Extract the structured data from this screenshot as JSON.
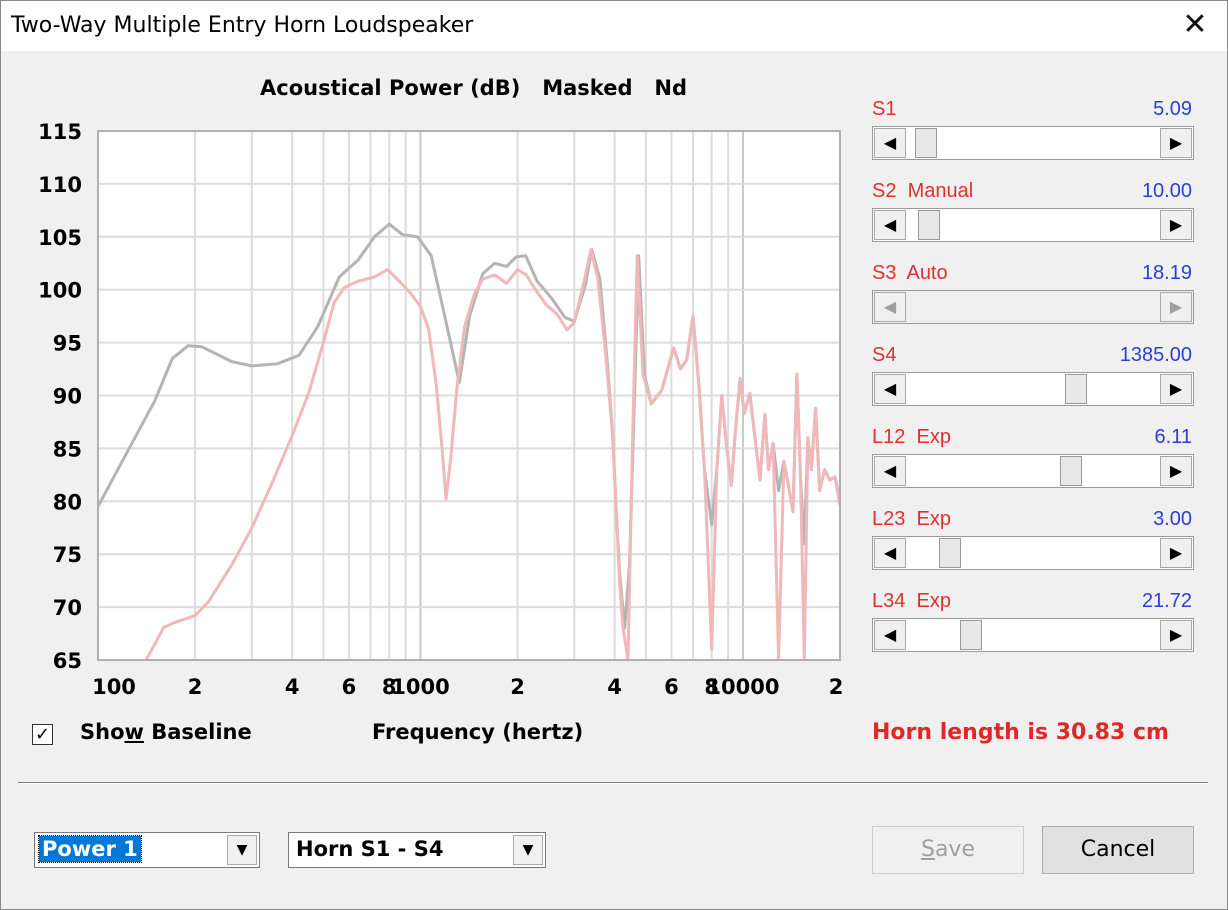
{
  "window": {
    "title": "Two-Way Multiple Entry Horn Loudspeaker",
    "close_glyph": "✕"
  },
  "chart_data": {
    "type": "line",
    "title": "Acoustical Power (dB)   Masked   Nd",
    "xlabel": "Frequency (hertz)",
    "ylabel": "",
    "xscale": "log",
    "xlim": [
      100,
      20000
    ],
    "ylim": [
      65,
      115
    ],
    "yticks": [
      115,
      110,
      105,
      100,
      95,
      90,
      85,
      80,
      75,
      70,
      65
    ],
    "xtick_labels": [
      {
        "x": 100,
        "label": "100"
      },
      {
        "x": 200,
        "label": "2"
      },
      {
        "x": 400,
        "label": "4"
      },
      {
        "x": 600,
        "label": "6"
      },
      {
        "x": 800,
        "label": "8"
      },
      {
        "x": 1000,
        "label": "1000"
      },
      {
        "x": 2000,
        "label": "2"
      },
      {
        "x": 4000,
        "label": "4"
      },
      {
        "x": 6000,
        "label": "6"
      },
      {
        "x": 8000,
        "label": "8"
      },
      {
        "x": 10000,
        "label": "10000"
      },
      {
        "x": 20000,
        "label": "2"
      }
    ],
    "grid": true,
    "series": [
      {
        "color": "#b4b4b4",
        "points": [
          [
            100,
            79.5
          ],
          [
            120,
            84
          ],
          [
            150,
            89.5
          ],
          [
            170,
            93.5
          ],
          [
            190,
            94.7
          ],
          [
            210,
            94.6
          ],
          [
            260,
            93.2
          ],
          [
            300,
            92.8
          ],
          [
            360,
            93.0
          ],
          [
            420,
            93.8
          ],
          [
            480,
            96.5
          ],
          [
            560,
            101.2
          ],
          [
            640,
            102.8
          ],
          [
            720,
            105.0
          ],
          [
            800,
            106.2
          ],
          [
            880,
            105.2
          ],
          [
            980,
            105.0
          ],
          [
            1080,
            103.2
          ],
          [
            1160,
            99
          ],
          [
            1240,
            95
          ],
          [
            1320,
            91.2
          ],
          [
            1420,
            97.5
          ],
          [
            1560,
            101.5
          ],
          [
            1700,
            102.5
          ],
          [
            1850,
            102.2
          ],
          [
            1980,
            103.1
          ],
          [
            2120,
            103.2
          ],
          [
            2300,
            100.8
          ],
          [
            2550,
            99.2
          ],
          [
            2800,
            97.4
          ],
          [
            3000,
            97.0
          ],
          [
            3250,
            100.5
          ],
          [
            3400,
            103.8
          ],
          [
            3600,
            101
          ],
          [
            3800,
            93
          ],
          [
            3950,
            86
          ],
          [
            4050,
            79
          ],
          [
            4150,
            73
          ],
          [
            4300,
            68
          ],
          [
            4450,
            74
          ],
          [
            4600,
            89
          ],
          [
            4750,
            103.2
          ],
          [
            4950,
            92
          ],
          [
            5200,
            89.2
          ],
          [
            5600,
            90.5
          ],
          [
            6100,
            94.5
          ],
          [
            6400,
            92.5
          ],
          [
            6700,
            93.4
          ],
          [
            7000,
            97.5
          ],
          [
            7300,
            91
          ],
          [
            7600,
            83
          ],
          [
            8000,
            77.8
          ],
          [
            8300,
            83
          ],
          [
            8600,
            90
          ],
          [
            8900,
            85.2
          ],
          [
            9200,
            81.5
          ],
          [
            9500,
            87
          ],
          [
            9800,
            91.6
          ],
          [
            10100,
            88.3
          ],
          [
            10500,
            90.2
          ],
          [
            10900,
            86
          ],
          [
            11300,
            82
          ],
          [
            11700,
            88.2
          ],
          [
            12000,
            83
          ],
          [
            12400,
            85.5
          ],
          [
            12900,
            81
          ],
          [
            13400,
            83.8
          ],
          [
            13900,
            81.2
          ],
          [
            14300,
            79
          ],
          [
            14700,
            92
          ],
          [
            15100,
            82
          ],
          [
            15500,
            76
          ],
          [
            15900,
            86
          ],
          [
            16300,
            83
          ],
          [
            16800,
            88.8
          ],
          [
            17300,
            81
          ],
          [
            17900,
            83
          ],
          [
            18600,
            82
          ],
          [
            19300,
            82.3
          ],
          [
            20000,
            80.1
          ]
        ]
      },
      {
        "color": "#f0b8b8",
        "points": [
          [
            100,
            57
          ],
          [
            130,
            63
          ],
          [
            150,
            66.5
          ],
          [
            160,
            68.1
          ],
          [
            175,
            68.6
          ],
          [
            200,
            69.2
          ],
          [
            220,
            70.5
          ],
          [
            260,
            74
          ],
          [
            300,
            77.5
          ],
          [
            350,
            82
          ],
          [
            400,
            86.2
          ],
          [
            450,
            90.2
          ],
          [
            500,
            95
          ],
          [
            540,
            98.8
          ],
          [
            580,
            100.2
          ],
          [
            640,
            100.8
          ],
          [
            720,
            101.2
          ],
          [
            790,
            101.9
          ],
          [
            860,
            100.8
          ],
          [
            930,
            99.7
          ],
          [
            1000,
            98.4
          ],
          [
            1060,
            96.3
          ],
          [
            1120,
            91.0
          ],
          [
            1170,
            84.5
          ],
          [
            1200,
            80.2
          ],
          [
            1240,
            84
          ],
          [
            1300,
            91
          ],
          [
            1370,
            96.5
          ],
          [
            1470,
            99.6
          ],
          [
            1560,
            101.0
          ],
          [
            1700,
            101.4
          ],
          [
            1850,
            100.6
          ],
          [
            2000,
            101.9
          ],
          [
            2130,
            101.4
          ],
          [
            2250,
            100.2
          ],
          [
            2450,
            98.6
          ],
          [
            2650,
            97.7
          ],
          [
            2850,
            96.2
          ],
          [
            3000,
            96.9
          ],
          [
            3200,
            100.5
          ],
          [
            3380,
            103.8
          ],
          [
            3550,
            101
          ],
          [
            3750,
            94
          ],
          [
            3950,
            86
          ],
          [
            4050,
            79
          ],
          [
            4150,
            72
          ],
          [
            4250,
            68
          ],
          [
            4400,
            65
          ],
          [
            4550,
            86
          ],
          [
            4700,
            103.2
          ],
          [
            4900,
            92
          ],
          [
            5200,
            89.2
          ],
          [
            5600,
            90.5
          ],
          [
            6100,
            94.5
          ],
          [
            6400,
            92.5
          ],
          [
            6700,
            93.4
          ],
          [
            7000,
            97.5
          ],
          [
            7300,
            91
          ],
          [
            7600,
            83
          ],
          [
            8000,
            66
          ],
          [
            8300,
            83
          ],
          [
            8600,
            90
          ],
          [
            8900,
            85.2
          ],
          [
            9200,
            81.5
          ],
          [
            9500,
            87
          ],
          [
            9800,
            91.6
          ],
          [
            10100,
            88.3
          ],
          [
            10500,
            90.2
          ],
          [
            10900,
            86
          ],
          [
            11300,
            82
          ],
          [
            11700,
            88.2
          ],
          [
            12000,
            83
          ],
          [
            12400,
            85.5
          ],
          [
            12900,
            65
          ],
          [
            13400,
            83.8
          ],
          [
            13900,
            81.2
          ],
          [
            14300,
            79
          ],
          [
            14700,
            92
          ],
          [
            15100,
            82
          ],
          [
            15500,
            65
          ],
          [
            15900,
            86
          ],
          [
            16300,
            83
          ],
          [
            16800,
            88.8
          ],
          [
            17300,
            81
          ],
          [
            17900,
            83
          ],
          [
            18600,
            82
          ],
          [
            19300,
            82.3
          ],
          [
            20000,
            79.6
          ]
        ]
      }
    ]
  },
  "baseline": {
    "checked": true,
    "check_glyph": "✓",
    "label_pre": "Sho",
    "label_ul": "w",
    "label_post": " Baseline"
  },
  "sliders": [
    {
      "label": "S1",
      "value": "5.09",
      "position": 0.04,
      "enabled": true
    },
    {
      "label": "S2  Manual",
      "value": "10.00",
      "position": 0.05,
      "enabled": true
    },
    {
      "label": "S3  Auto",
      "value": "18.19",
      "position": null,
      "enabled": false
    },
    {
      "label": "S4",
      "value": "1385.00",
      "position": 0.68,
      "enabled": true
    },
    {
      "label": "L12  Exp",
      "value": "6.11",
      "position": 0.66,
      "enabled": true
    },
    {
      "label": "L23  Exp",
      "value": "3.00",
      "position": 0.14,
      "enabled": true
    },
    {
      "label": "L34  Exp",
      "value": "21.72",
      "position": 0.23,
      "enabled": true
    }
  ],
  "arrows": {
    "left": "◀",
    "right": "▶",
    "down": "▼"
  },
  "horn_length": "Horn length is 30.83 cm",
  "combo1": {
    "value": "Power 1"
  },
  "combo2": {
    "value": "Horn S1 - S4"
  },
  "buttons": {
    "save_ul": "S",
    "save_rest": "ave",
    "save_enabled": false,
    "cancel": "Cancel"
  }
}
